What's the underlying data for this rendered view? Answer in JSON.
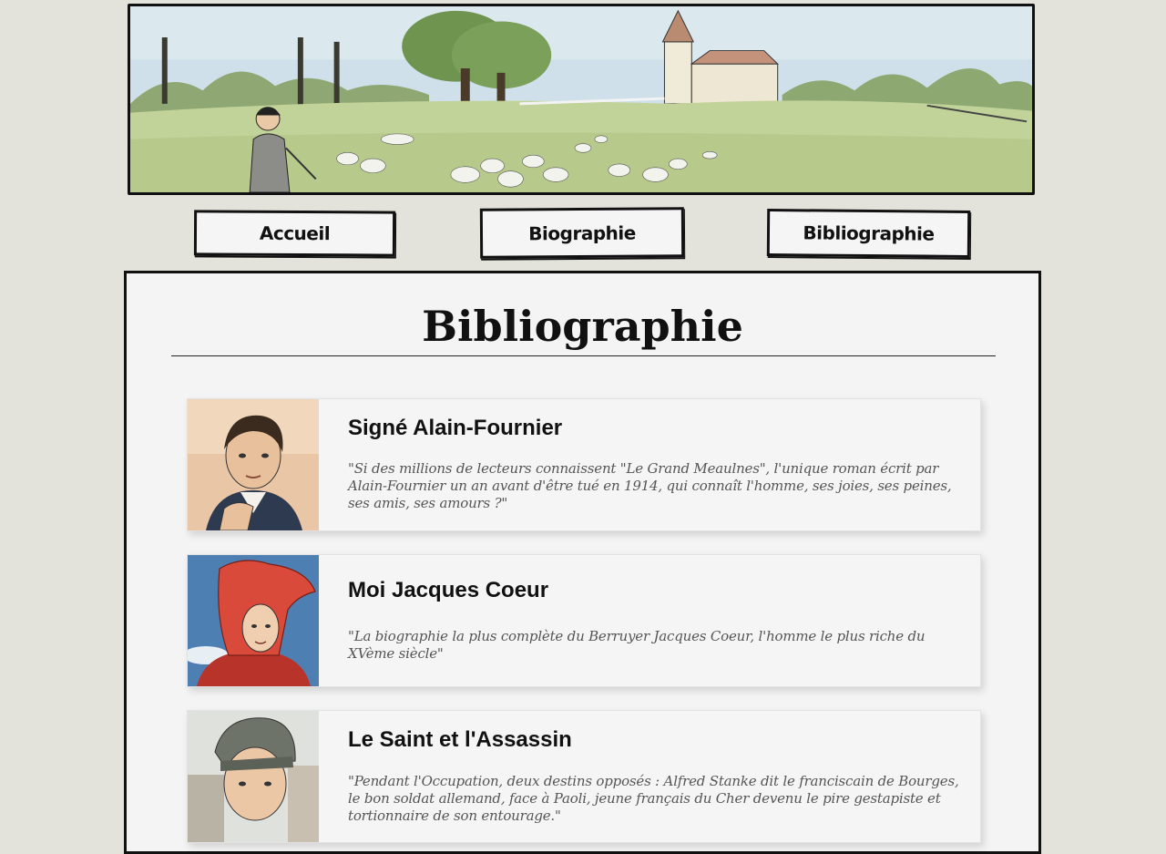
{
  "nav": {
    "items": [
      {
        "label": "Accueil"
      },
      {
        "label": "Biographie"
      },
      {
        "label": "Bibliographie"
      }
    ]
  },
  "main": {
    "title": "Bibliographie",
    "books": [
      {
        "title": "Signé Alain-Fournier",
        "quote": "\"Si des millions de lecteurs connaissent \"Le Grand Meaulnes\", l'unique roman écrit par Alain-Fournier un an avant d'être tué en 1914, qui connaît l'homme, ses joies, ses peines, ses amis, ses amours ?\""
      },
      {
        "title": "Moi Jacques Coeur",
        "quote": "\"La biographie la plus complète du Berruyer Jacques Coeur, l'homme le plus riche du XVème siècle\""
      },
      {
        "title": "Le Saint et l'Assassin",
        "quote": "\"Pendant l'Occupation, deux destins opposés : Alfred Stanke dit le franciscain de Bourges, le bon soldat allemand, face à Paoli, jeune français du Cher devenu le pire gestapiste et tortionnaire de son entourage.\""
      }
    ]
  },
  "colors": {
    "page_background": "#e3e3dc",
    "panel_background": "#f4f4f4",
    "border": "#111111"
  }
}
